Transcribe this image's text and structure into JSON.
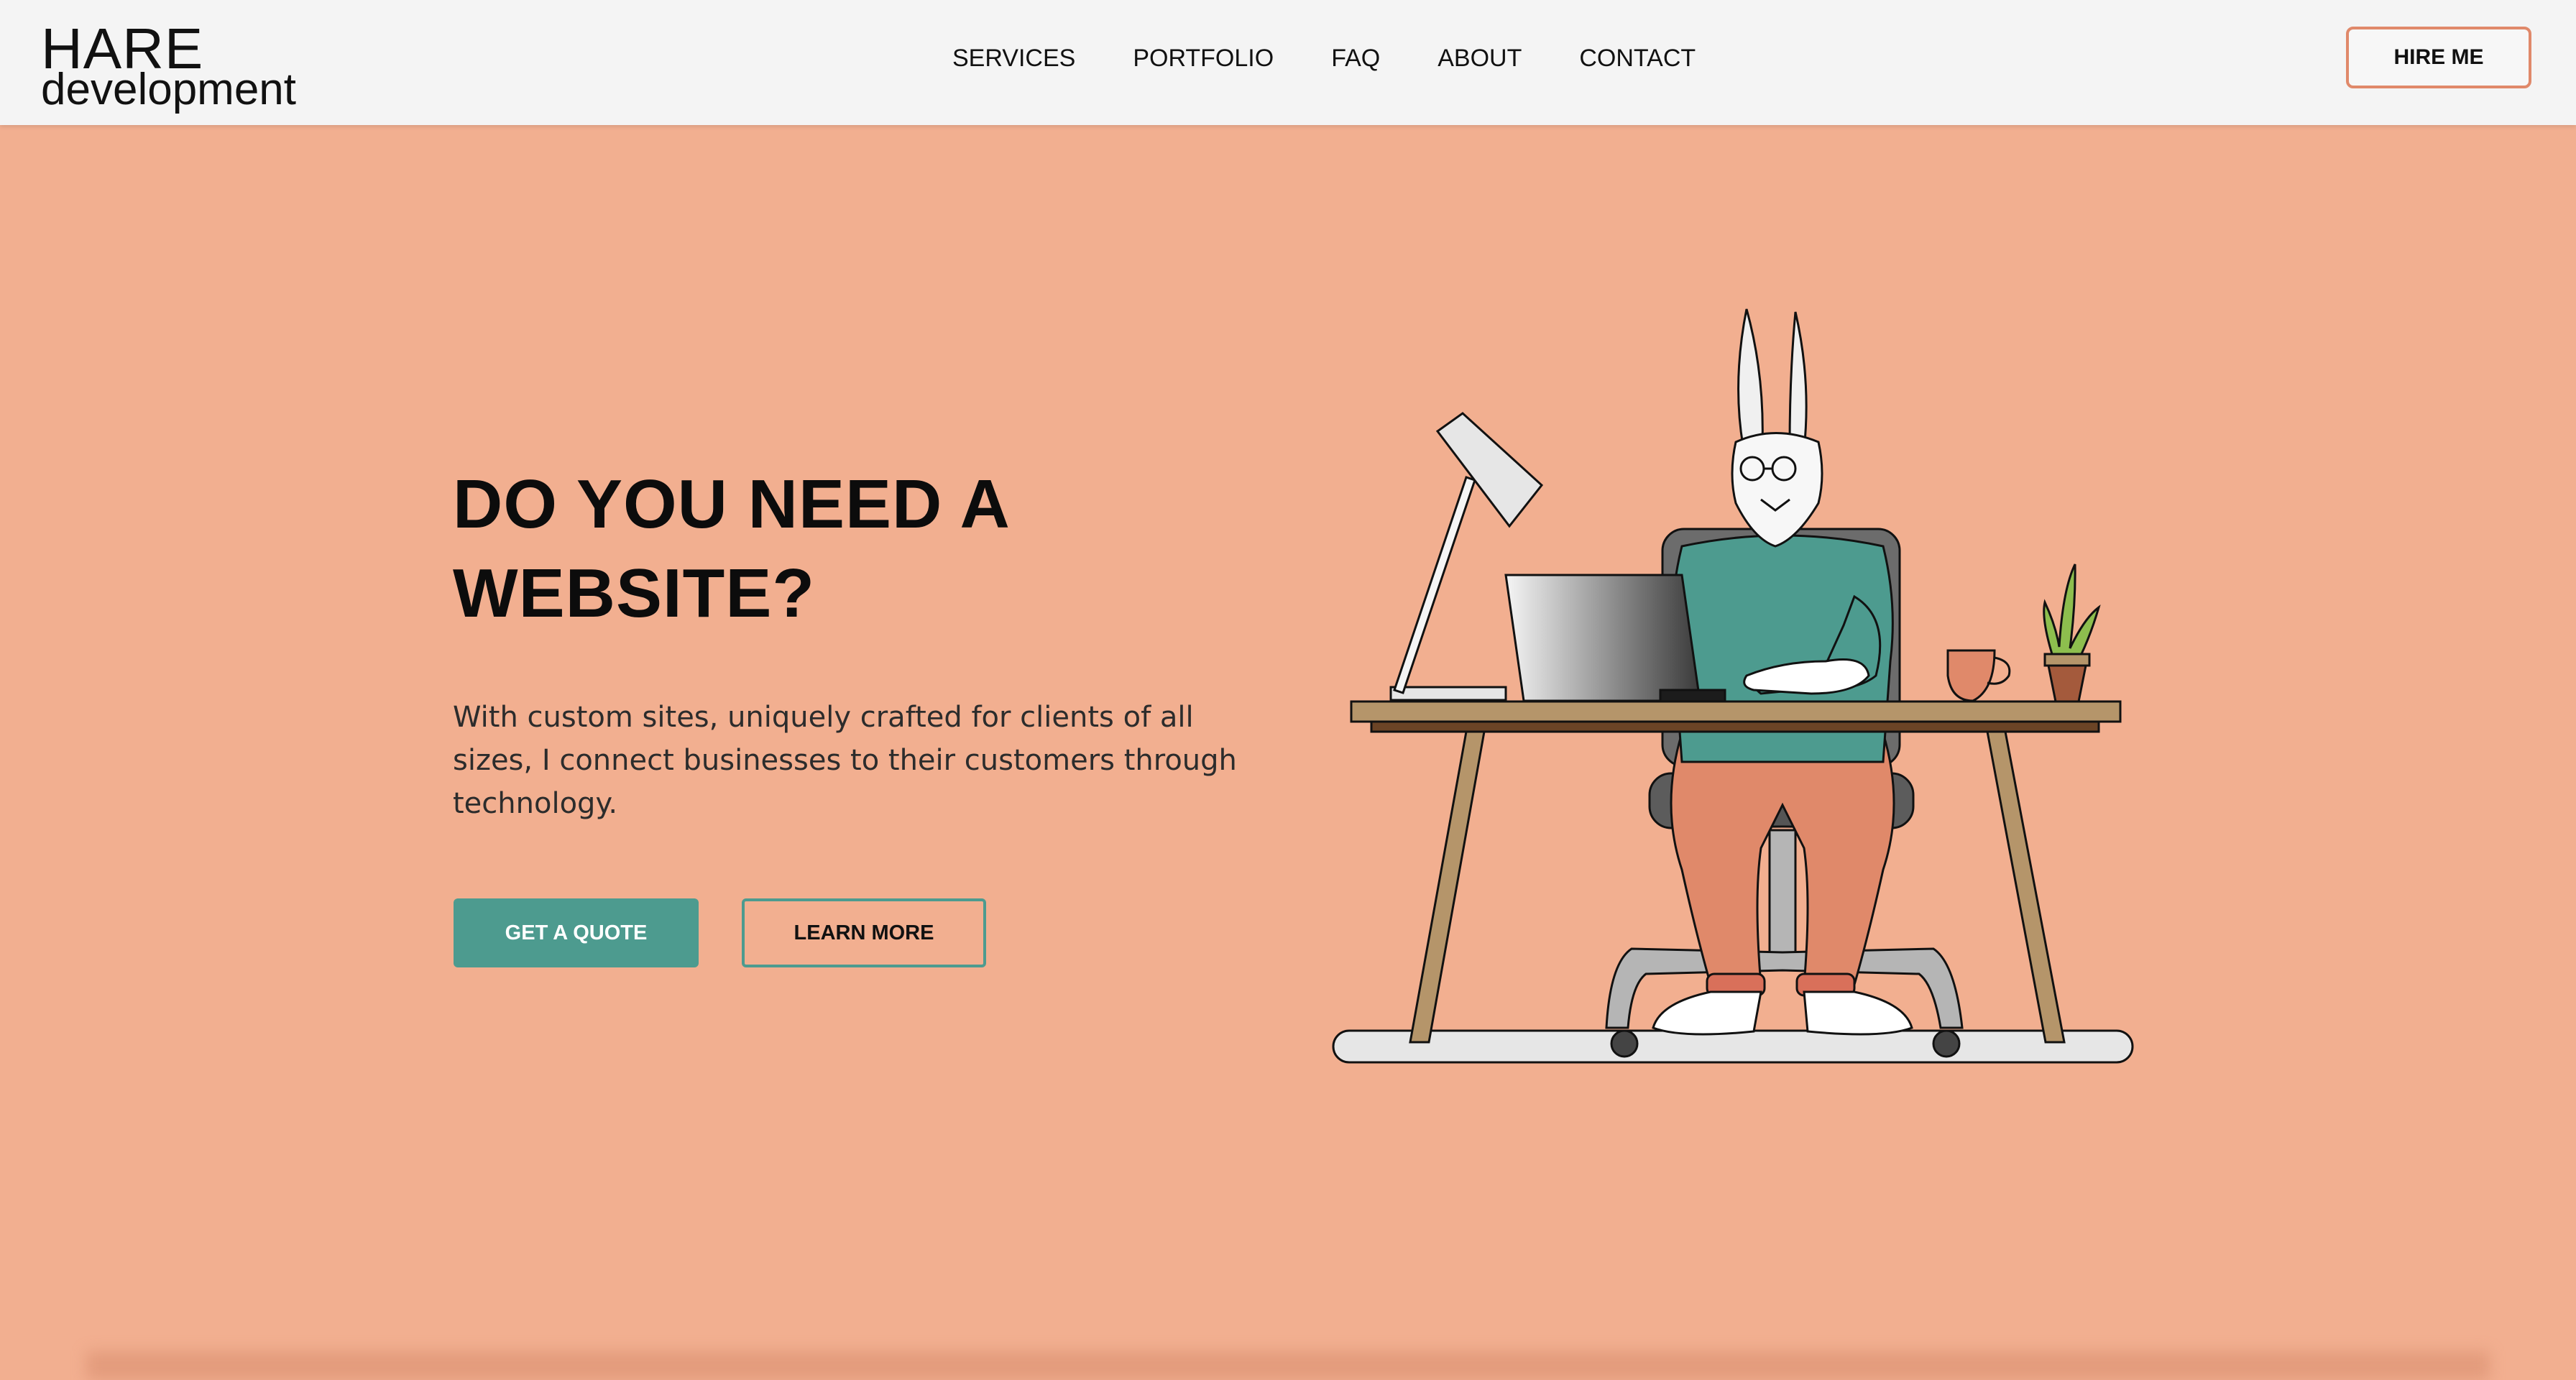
{
  "header": {
    "logo_top": "HARE",
    "logo_bottom": "development",
    "nav": [
      "SERVICES",
      "PORTFOLIO",
      "FAQ",
      "ABOUT",
      "CONTACT"
    ],
    "hire_label": "HIRE ME"
  },
  "hero": {
    "title_line1": "DO YOU NEED A",
    "title_line2": "WEBSITE?",
    "description": "With custom sites, uniquely crafted for clients of all sizes, I connect businesses to their customers through technology.",
    "primary_button": "GET A QUOTE",
    "secondary_button": "LEARN MORE"
  },
  "colors": {
    "background": "#f2af90",
    "header_bg": "#f4f4f4",
    "accent_teal": "#4d9b8f",
    "accent_orange": "#e0896a",
    "text_dark": "#0c0c0c"
  },
  "icons": {
    "illustration": "hare-at-desk-illustration"
  }
}
